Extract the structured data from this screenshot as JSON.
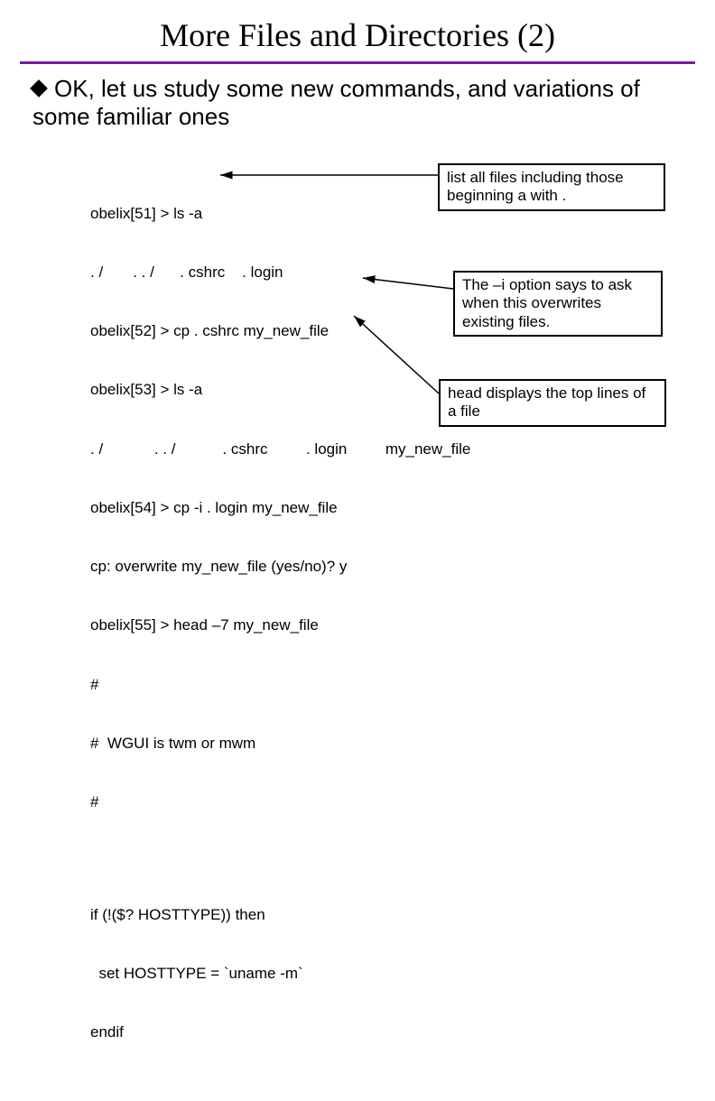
{
  "title": "More Files and Directories (2)",
  "body": "OK, let us study some new commands, and variations of some familiar ones",
  "terminal": {
    "l1": "obelix[51] > ls -a",
    "l2": ". /       . . /      . cshrc    . login",
    "l3": "obelix[52] > cp . cshrc my_new_file",
    "l4": "obelix[53] > ls -a",
    "l5": ". /            . . /           . cshrc         . login         my_new_file",
    "l6": "obelix[54] > cp -i . login my_new_file",
    "l7": "cp: overwrite my_new_file (yes/no)? y",
    "l8": "obelix[55] > head –7 my_new_file",
    "l9": "#",
    "l10": "#  WGUI is twm or mwm",
    "l11": "#",
    "l12": "if (!($? HOSTTYPE)) then",
    "l13": "  set HOSTTYPE = `uname -m`",
    "l14": "endif"
  },
  "callouts": {
    "c1": "list all files including those beginning a with .",
    "c2": "The –i option says to ask when this overwrites existing files.",
    "c3": "head displays the top lines of a file"
  }
}
